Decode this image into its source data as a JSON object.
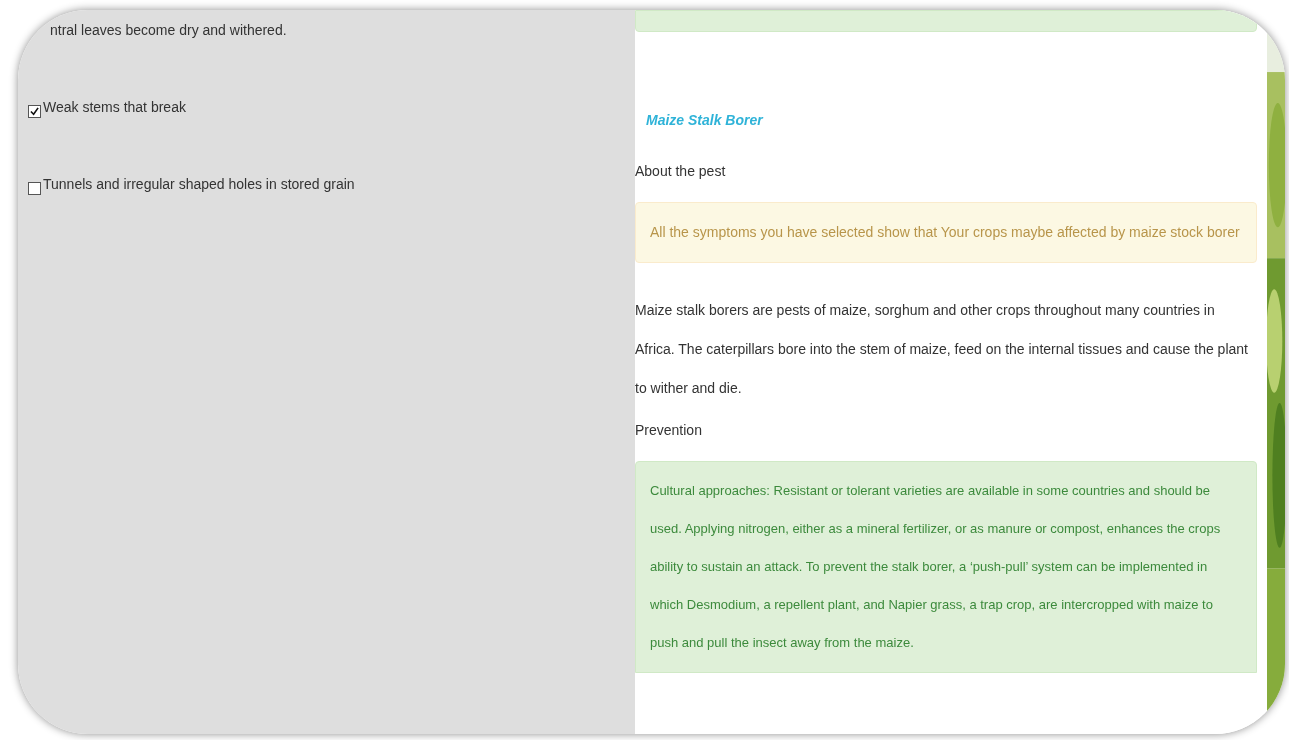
{
  "left": {
    "intro": "ntral leaves become dry and withered.",
    "symptoms": [
      {
        "label": "Weak stems that break",
        "checked": true
      },
      {
        "label": "Tunnels and irregular shaped holes in stored grain",
        "checked": false
      }
    ]
  },
  "right": {
    "title": "Maize Stalk Borer",
    "about_heading": "About the pest",
    "alert": "All the symptoms you have selected show that Your crops maybe affected by maize stock borer",
    "description": "Maize stalk borers are pests of maize, sorghum and other crops throughout many countries in Africa. The caterpillars bore into the stem of maize, feed on the internal tissues and cause the plant to wither and die.",
    "prevention_heading": "Prevention",
    "prevention": "Cultural approaches: Resistant or tolerant varieties are available in some countries and should be used. Applying nitrogen, either as a mineral fertilizer, or as manure or compost, enhances the crops ability to sustain an attack. To prevent the stalk borer, a ‘push-pull’ system can be implemented in which Desmodium, a repellent plant, and Napier grass, a trap crop, are intercropped with maize to push and pull the insect away from the maize."
  }
}
